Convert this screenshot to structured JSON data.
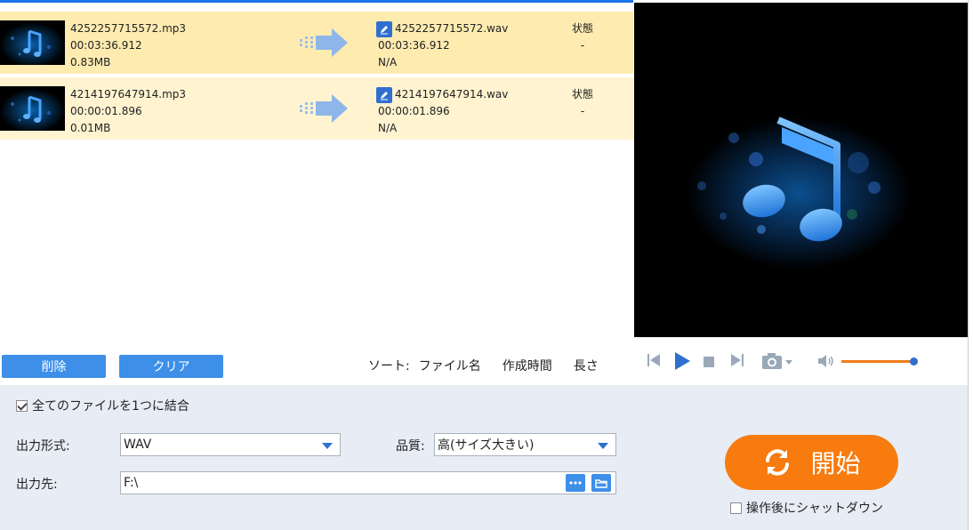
{
  "files": [
    {
      "source": {
        "name": "4252257715572.mp3",
        "duration": "00:03:36.912",
        "size": "0.83MB"
      },
      "output": {
        "name": "4252257715572.wav",
        "duration": "00:03:36.912",
        "size": "N/A"
      },
      "status_label": "状態",
      "status_value": "-"
    },
    {
      "source": {
        "name": "4214197647914.mp3",
        "duration": "00:00:01.896",
        "size": "0.01MB"
      },
      "output": {
        "name": "4214197647914.wav",
        "duration": "00:00:01.896",
        "size": "N/A"
      },
      "status_label": "状態",
      "status_value": "-"
    }
  ],
  "actions": {
    "delete_label": "削除",
    "clear_label": "クリア"
  },
  "sort": {
    "label": "ソート:",
    "options": [
      "ファイル名",
      "作成時間",
      "長さ"
    ]
  },
  "player": {
    "volume_fraction": 1.0,
    "accent_color": "#f07c18",
    "knob_color": "#2f6fd0"
  },
  "bottom": {
    "merge_label": "全てのファイルを1つに結合",
    "merge_checked": true,
    "format_label": "出力形式:",
    "format_value": "WAV",
    "quality_label": "品質:",
    "quality_value": "高(サイズ大きい)",
    "dest_label": "出力先:",
    "dest_value": "F:\\",
    "start_label": "開始",
    "shutdown_label": "操作後にシャットダウン",
    "shutdown_checked": false
  },
  "colors": {
    "row_selected": "#fdebb0",
    "row_alt": "#fff3d0",
    "button_blue": "#3d8fe8",
    "start_orange": "#f77b0e",
    "panel_bg": "#e8edf5"
  },
  "icons": [
    "music-note-thumbnail",
    "convert-arrow-icon",
    "edit-icon",
    "skip-back-icon",
    "play-icon",
    "stop-icon",
    "skip-forward-icon",
    "camera-icon",
    "volume-icon",
    "more-icon",
    "folder-icon",
    "refresh-icon"
  ]
}
